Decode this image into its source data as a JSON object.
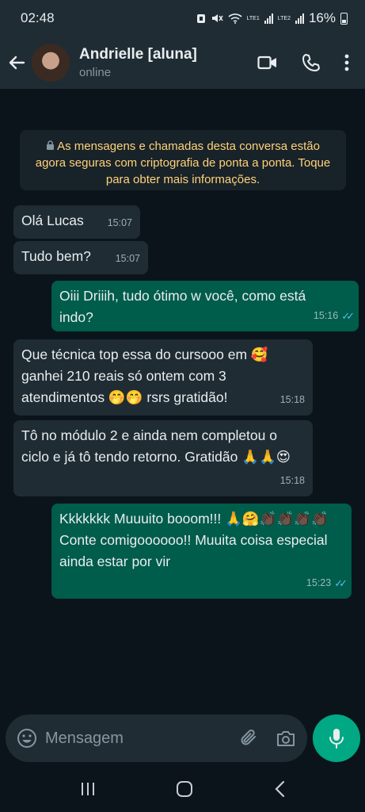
{
  "status_bar": {
    "time": "02:48",
    "signal1_label": "LTE1",
    "signal2_label": "LTE2",
    "battery": "16%"
  },
  "header": {
    "contact_name": "Andrielle [aluna]",
    "status": "online"
  },
  "system_message": {
    "text": "As mensagens e chamadas desta conversa estão agora seguras com criptografia de ponta a ponta. Toque para obter mais informações."
  },
  "messages": [
    {
      "direction": "in",
      "text": "Olá Lucas",
      "time": "15:07"
    },
    {
      "direction": "in",
      "text": "Tudo bem?",
      "time": "15:07"
    },
    {
      "direction": "out",
      "text": "Oiii Driiih, tudo ótimo w você, como está indo?",
      "time": "15:16"
    },
    {
      "direction": "in",
      "text": "Que técnica top essa do cursooo em 🥰 ganhei 210 reais só ontem com 3 atendimentos 🤭🤭 rsrs gratidão!",
      "time": "15:18"
    },
    {
      "direction": "in",
      "text": "Tô no módulo 2 e ainda nem completou o ciclo e já tô tendo retorno. Gratidão 🙏🙏😍",
      "time": "15:18"
    },
    {
      "direction": "out",
      "text": "Kkkkkkk Muuuito booom!!! 🙏🤗👏🏿👏🏿👏🏿👏🏿 Conte comigoooooo!! Muuita coisa especial ainda estar por vir",
      "time": "15:23"
    }
  ],
  "input": {
    "placeholder": "Mensagem"
  },
  "colors": {
    "background": "#0b141a",
    "header": "#1f2c34",
    "incoming_bubble": "#1f2c34",
    "outgoing_bubble": "#005c4b",
    "accent": "#00a884",
    "read_ticks": "#53bdeb",
    "system_text": "#ffd279"
  },
  "icons": [
    "back-arrow-icon",
    "video-call-icon",
    "phone-icon",
    "more-options-icon",
    "lock-icon",
    "emoji-icon",
    "attach-icon",
    "camera-icon",
    "mic-icon",
    "recents-icon",
    "home-icon",
    "back-nav-icon"
  ]
}
